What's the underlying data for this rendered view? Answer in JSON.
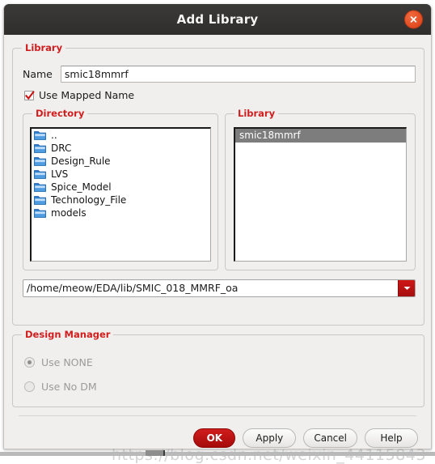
{
  "window": {
    "title": "Add Library",
    "close_icon": "close-x-icon"
  },
  "library_group": {
    "title": "Library",
    "name_label": "Name",
    "name_value": "smic18mmrf",
    "name_placeholder": "",
    "mapped_name_label": "Use Mapped Name",
    "mapped_name_checked": true
  },
  "directory_group": {
    "title": "Directory",
    "items": [
      {
        "label": "..",
        "icon": "folder-icon"
      },
      {
        "label": "DRC",
        "icon": "folder-icon"
      },
      {
        "label": "Design_Rule",
        "icon": "folder-icon"
      },
      {
        "label": "LVS",
        "icon": "folder-icon"
      },
      {
        "label": "Spice_Model",
        "icon": "folder-icon"
      },
      {
        "label": "Technology_File",
        "icon": "folder-icon"
      },
      {
        "label": "models",
        "icon": "folder-icon"
      }
    ]
  },
  "library_list_group": {
    "title": "Library",
    "items": [
      {
        "label": "smic18mmrf",
        "selected": true
      }
    ]
  },
  "path_combo": {
    "value": "/home/meow/EDA/lib/SMIC_018_MMRF_oa",
    "dropdown_icon": "chevron-down-icon",
    "dropdown_color": "#bc1313"
  },
  "design_manager": {
    "title": "Design Manager",
    "options": [
      {
        "label": "Use  NONE",
        "selected": true,
        "disabled": true
      },
      {
        "label": "Use No DM",
        "selected": false,
        "disabled": true
      }
    ]
  },
  "footer": {
    "ok_label": "OK",
    "apply_label": "Apply",
    "cancel_label": "Cancel",
    "help_label": "Help"
  },
  "watermark": {
    "text": "https://blog.csdn.net/weixin_44115843"
  },
  "colors": {
    "group_title": "#d01e1e",
    "titlebar": "#33322f",
    "close_button": "#e1491f",
    "ok_button": "#bc1313",
    "selection": "#7d7d7d",
    "folder": "#3a8ede"
  }
}
